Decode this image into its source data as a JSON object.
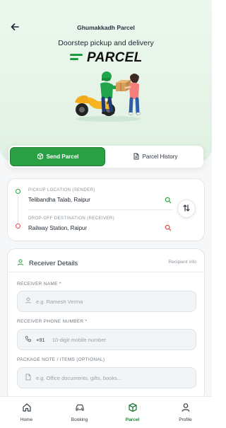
{
  "header": {
    "app_title": "Ghumakkadh Parcel",
    "tagline": "Doorstep pickup and delivery",
    "brand_word": "PARCEL"
  },
  "tabs": [
    {
      "label": "Send Parcel",
      "icon": "package-icon",
      "active": true
    },
    {
      "label": "Parcel History",
      "icon": "document-icon",
      "active": false
    }
  ],
  "locations": {
    "pickup_label": "PICKUP LOCATION (SENDER)",
    "pickup_value": "Telibandha Talab, Raipur",
    "dropoff_label": "DROP-OFF DESTINATION (RECEIVER)",
    "dropoff_value": "Railway Station, Raipur"
  },
  "receiver": {
    "title": "Receiver Details",
    "helper": "Recipient info",
    "name_label": "RECEIVER NAME *",
    "name_placeholder": "e.g. Ramesh Verma",
    "phone_label": "RECEIVER PHONE NUMBER *",
    "country_code": "+91",
    "phone_placeholder": "10-digit mobile number",
    "note_label": "PACKAGE NOTE / ITEMS (OPTIONAL)",
    "note_placeholder": "e.g. Office documents, gifts, books..."
  },
  "bottom_nav": [
    {
      "label": "Home",
      "icon": "home-icon",
      "active": false
    },
    {
      "label": "Booking",
      "icon": "car-icon",
      "active": false
    },
    {
      "label": "Parcel",
      "icon": "package-icon",
      "active": true
    },
    {
      "label": "Profile",
      "icon": "profile-icon",
      "active": false
    }
  ],
  "colors": {
    "accent": "#2a9f44",
    "pickup": "#28a745",
    "dropoff": "#e34b4b"
  }
}
